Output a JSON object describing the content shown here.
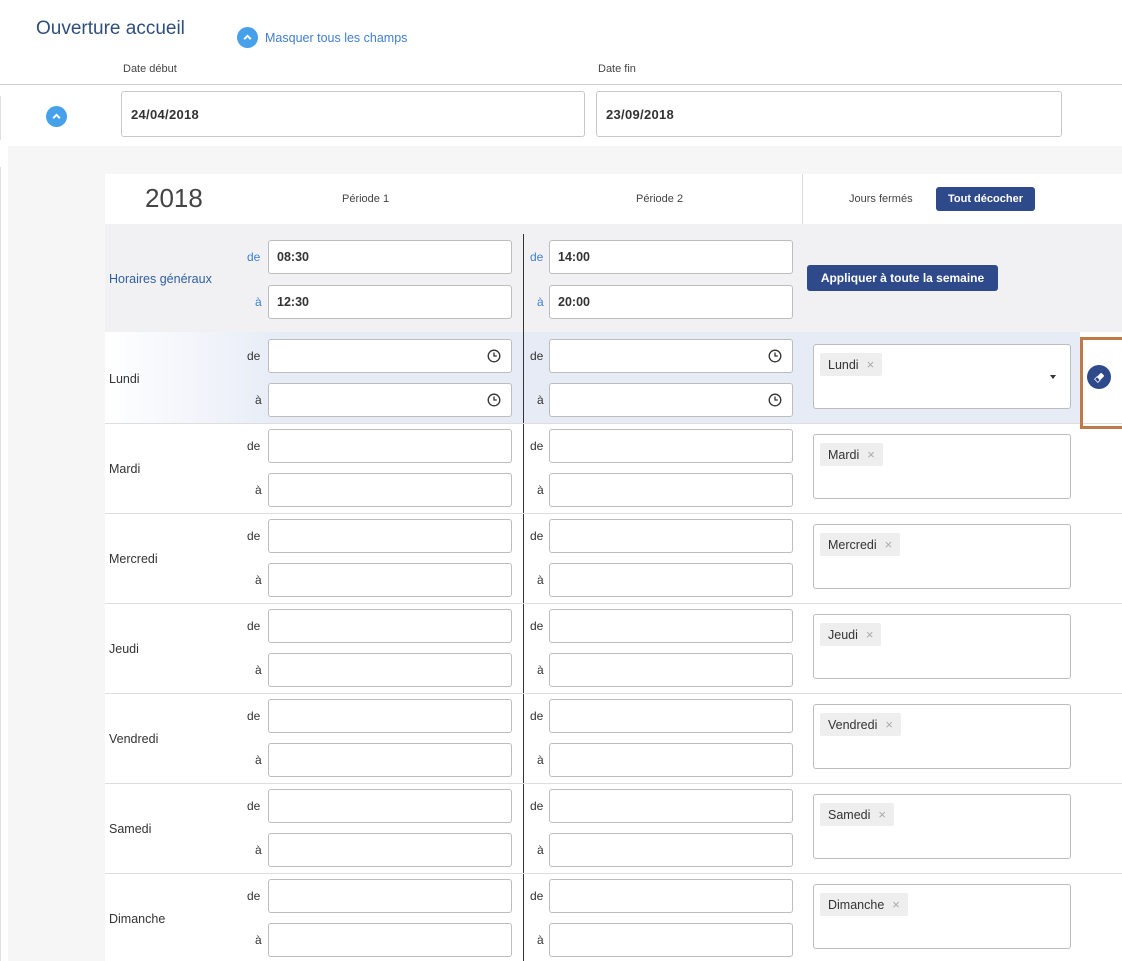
{
  "page": {
    "title": "Ouverture accueil",
    "toggle_all_label": "Masquer tous les champs"
  },
  "dates": {
    "start_label": "Date début",
    "end_label": "Date fin",
    "start_value": "24/04/2018",
    "end_value": "23/09/2018"
  },
  "schedule": {
    "year": "2018",
    "period1_label": "Période 1",
    "period2_label": "Période 2",
    "closed_days_label": "Jours fermés",
    "uncheck_all_label": "Tout décocher",
    "general_hours_label": "Horaires généraux",
    "apply_week_label": "Appliquer à toute la semaine",
    "from_prefix": "de",
    "to_prefix": "à",
    "general": {
      "p1_from": "08:30",
      "p1_to": "12:30",
      "p2_from": "14:00",
      "p2_to": "20:00"
    },
    "days": [
      {
        "name": "Lundi",
        "tag": "Lundi"
      },
      {
        "name": "Mardi",
        "tag": "Mardi"
      },
      {
        "name": "Mercredi",
        "tag": "Mercredi"
      },
      {
        "name": "Jeudi",
        "tag": "Jeudi"
      },
      {
        "name": "Vendredi",
        "tag": "Vendredi"
      },
      {
        "name": "Samedi",
        "tag": "Samedi"
      },
      {
        "name": "Dimanche",
        "tag": "Dimanche"
      }
    ],
    "tag_remove_glyph": "×"
  },
  "colors": {
    "accent_blue": "#46a0ea",
    "dark_button": "#2f4a8a",
    "highlight_border": "#c07a45"
  },
  "icons": {
    "toggle": "chevron-up-icon",
    "time": "clock-icon",
    "erase": "eraser-icon"
  }
}
